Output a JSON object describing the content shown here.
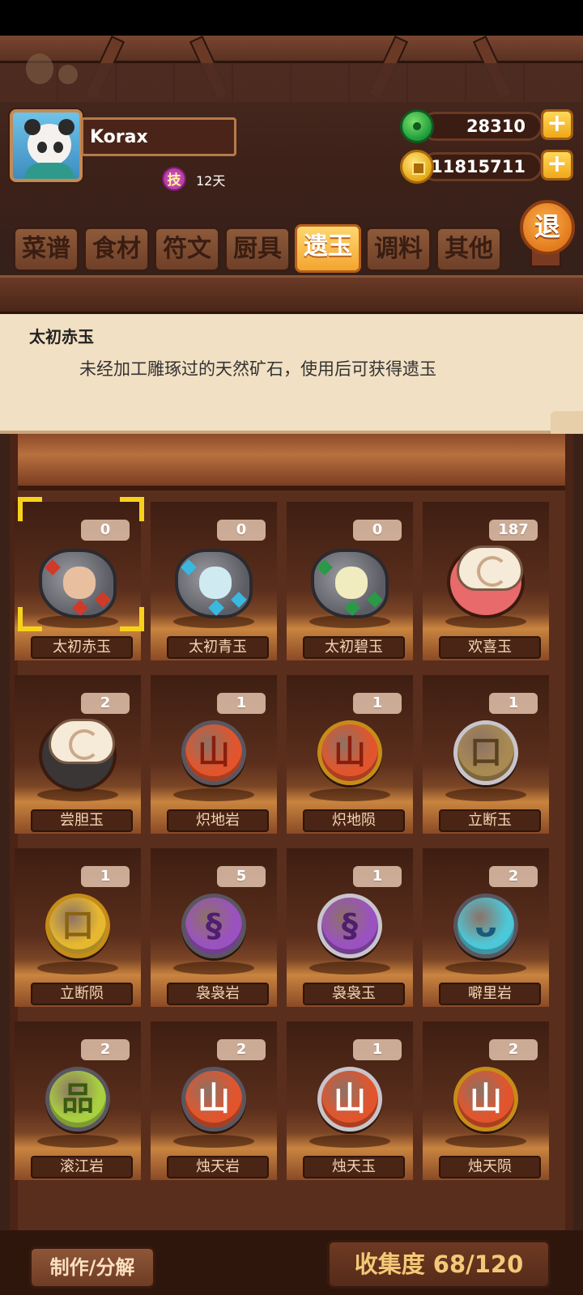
{
  "profile": {
    "name": "Korax",
    "skill_badge": "技",
    "days": "12天"
  },
  "currency": {
    "jade": "28310",
    "coins": "11815711",
    "plus": "+"
  },
  "exit_label": "退",
  "tabs": [
    {
      "label": "菜谱",
      "active": false
    },
    {
      "label": "食材",
      "active": false
    },
    {
      "label": "符文",
      "active": false
    },
    {
      "label": "厨具",
      "active": false
    },
    {
      "label": "遗玉",
      "active": true
    },
    {
      "label": "调料",
      "active": false
    },
    {
      "label": "其他",
      "active": false
    }
  ],
  "description": {
    "title": "太初赤玉",
    "text": "未经加工雕琢过的天然矿石，使用后可获得遗玉"
  },
  "items": [
    {
      "name": "太初赤玉",
      "count": "0",
      "kind": "rock",
      "color": "#e8c0a0",
      "accent": "#d03a28",
      "selected": true
    },
    {
      "name": "太初青玉",
      "count": "0",
      "kind": "rock",
      "color": "#cfeaf0",
      "accent": "#3ab8e0"
    },
    {
      "name": "太初碧玉",
      "count": "0",
      "kind": "rock",
      "color": "#f0ecc0",
      "accent": "#2a9a48"
    },
    {
      "name": "欢喜玉",
      "count": "187",
      "kind": "swirl",
      "color": "#e86a6a"
    },
    {
      "name": "尝胆玉",
      "count": "2",
      "kind": "swirl",
      "color": "#3a3636"
    },
    {
      "name": "炽地岩",
      "count": "1",
      "kind": "gem",
      "ring": "iron",
      "color": "#e2552c",
      "glyph": "山",
      "glyph_color": "#8a1e0c"
    },
    {
      "name": "炽地陨",
      "count": "1",
      "kind": "gem",
      "ring": "gold",
      "color": "#e2552c",
      "glyph": "山",
      "glyph_color": "#8a1e0c"
    },
    {
      "name": "立断玉",
      "count": "1",
      "kind": "gem",
      "ring": "silver",
      "color": "#a88a52",
      "glyph": "口",
      "glyph_color": "#5a4220"
    },
    {
      "name": "立断陨",
      "count": "1",
      "kind": "gem",
      "ring": "gold",
      "color": "#e6b830",
      "glyph": "口",
      "glyph_color": "#8a6410"
    },
    {
      "name": "袅袅岩",
      "count": "5",
      "kind": "gem",
      "ring": "iron",
      "color": "#9a52c0",
      "glyph": "§",
      "glyph_color": "#4e1e70"
    },
    {
      "name": "袅袅玉",
      "count": "1",
      "kind": "gem",
      "ring": "silver",
      "color": "#9a52c0",
      "glyph": "§",
      "glyph_color": "#4e1e70"
    },
    {
      "name": "噼里岩",
      "count": "2",
      "kind": "gem",
      "ring": "iron",
      "color": "#4cc8d8",
      "glyph": "ᴗ",
      "glyph_color": "#1a5a7a"
    },
    {
      "name": "滚江岩",
      "count": "2",
      "kind": "gem",
      "ring": "iron",
      "color": "#a8d040",
      "glyph": "品",
      "glyph_color": "#3a5a10"
    },
    {
      "name": "烛天岩",
      "count": "2",
      "kind": "gem",
      "ring": "iron",
      "color": "#e2552c",
      "glyph": "山",
      "glyph_color": "#ffffff"
    },
    {
      "name": "烛天玉",
      "count": "1",
      "kind": "gem",
      "ring": "silver",
      "color": "#e2552c",
      "glyph": "山",
      "glyph_color": "#ffffff"
    },
    {
      "name": "烛天陨",
      "count": "2",
      "kind": "gem",
      "ring": "gold",
      "color": "#e2552c",
      "glyph": "山",
      "glyph_color": "#ffffff"
    }
  ],
  "bottom": {
    "make_label": "制作/分解",
    "collection_label": "收集度 68/120"
  }
}
